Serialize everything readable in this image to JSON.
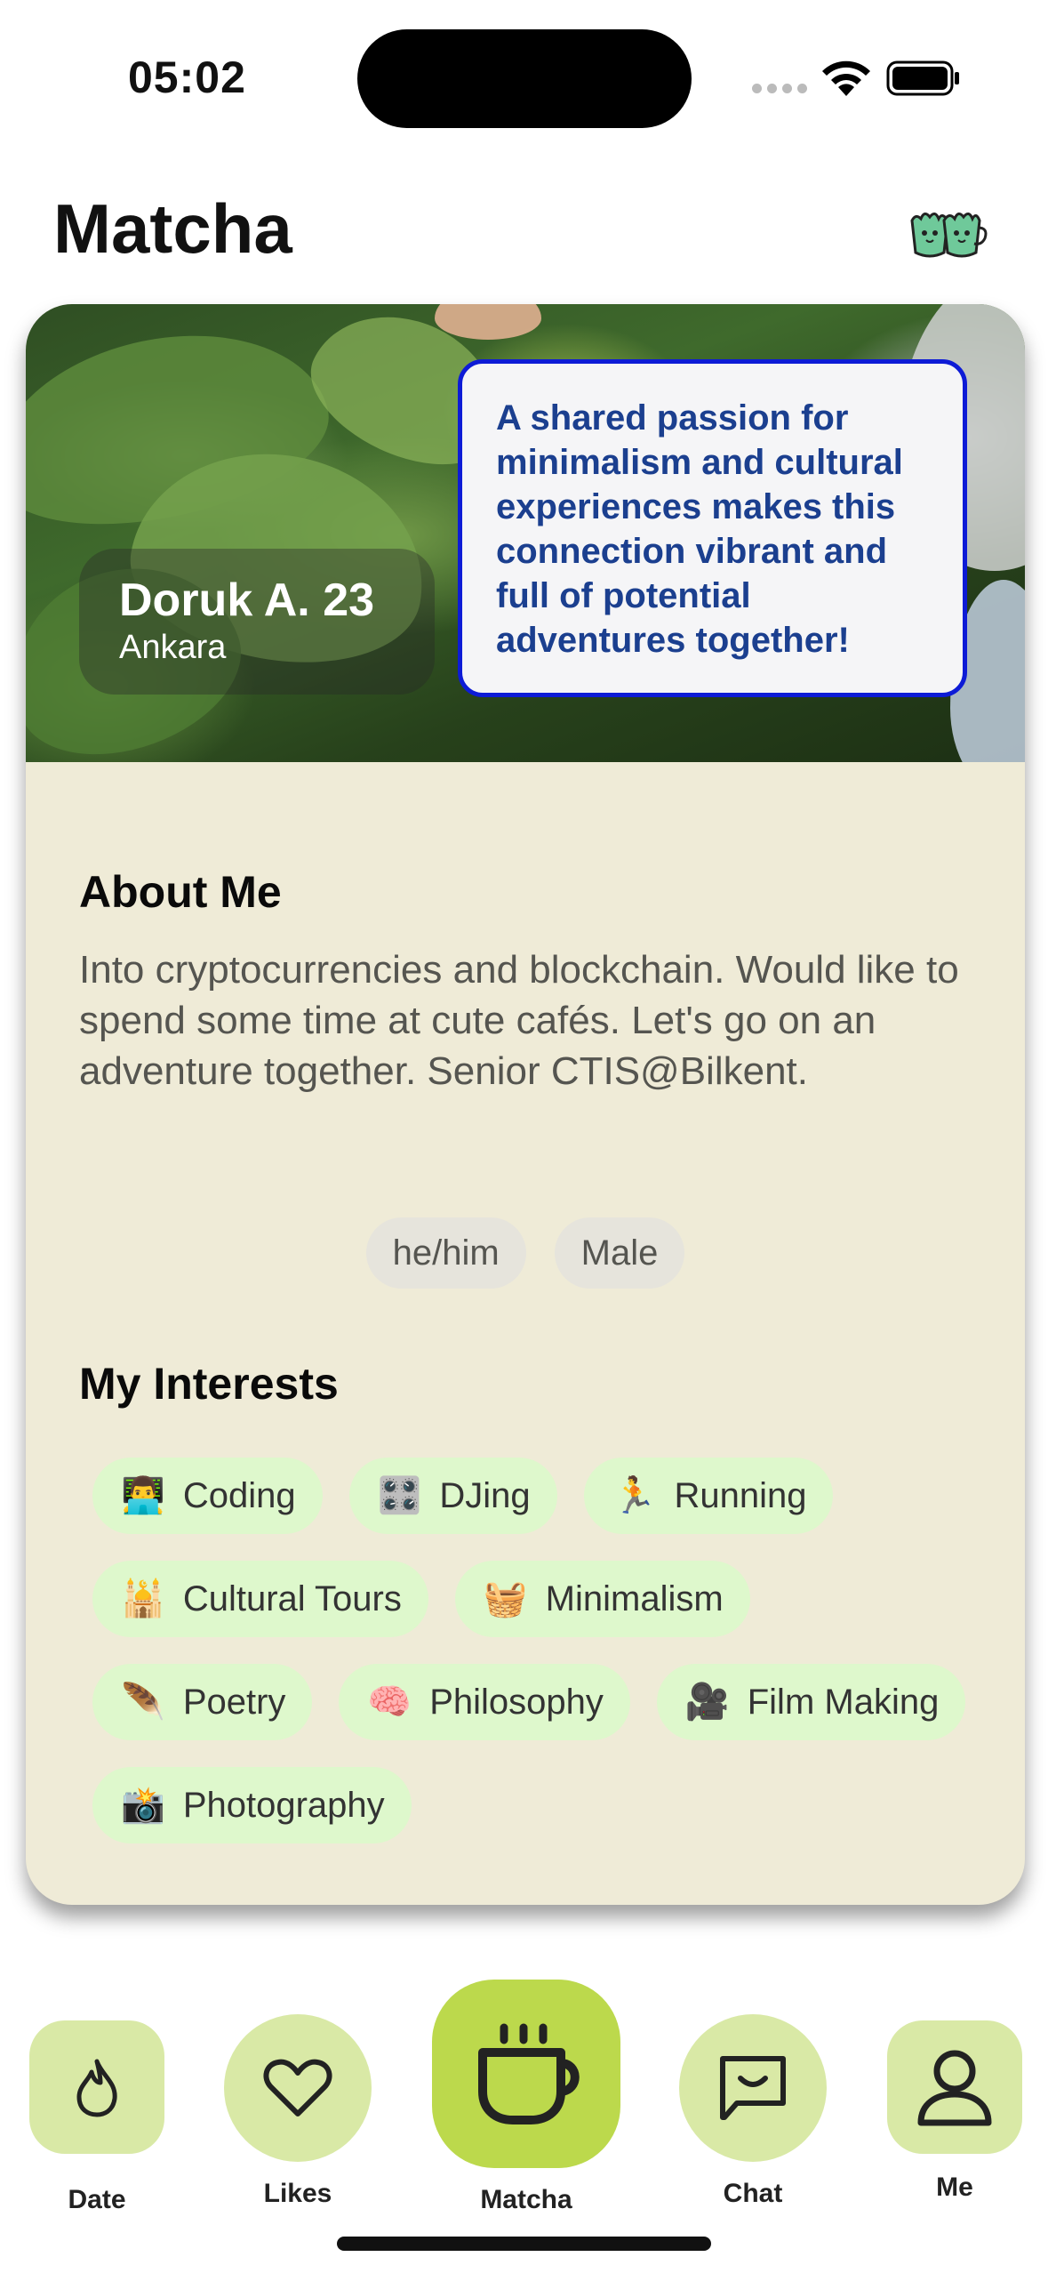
{
  "status_bar": {
    "time": "05:02"
  },
  "header": {
    "title": "Matcha",
    "logo_icon": "matcha-cups-logo"
  },
  "profile": {
    "name_age": "Doruk A. 23",
    "city": "Ankara",
    "match_note": "A shared passion for minimalism and cultural experiences makes this connection vibrant and full of potential adventures together!",
    "about_title": "About Me",
    "about_text": "Into cryptocurrencies and blockchain. Would like to spend some time at cute cafés. Let's go on an adventure together. Senior CTIS@Bilkent.",
    "pronouns": "he/him",
    "gender": "Male",
    "interests_title": "My Interests",
    "interests": [
      {
        "emoji": "👨‍💻",
        "label": "Coding"
      },
      {
        "emoji": "🎛️",
        "label": "DJing"
      },
      {
        "emoji": "🏃",
        "label": "Running"
      },
      {
        "emoji": "🕌",
        "label": "Cultural Tours"
      },
      {
        "emoji": "🧺",
        "label": "Minimalism"
      },
      {
        "emoji": "🪶",
        "label": "Poetry"
      },
      {
        "emoji": "🧠",
        "label": "Philosophy"
      },
      {
        "emoji": "🎥",
        "label": "Film Making"
      },
      {
        "emoji": "📸",
        "label": "Photography"
      }
    ]
  },
  "tab_bar": {
    "items": [
      {
        "label": "Date",
        "icon": "flame-icon"
      },
      {
        "label": "Likes",
        "icon": "heart-icon"
      },
      {
        "label": "Matcha",
        "icon": "cup-icon"
      },
      {
        "label": "Chat",
        "icon": "chat-icon"
      },
      {
        "label": "Me",
        "icon": "person-icon"
      }
    ],
    "selected": "Matcha"
  },
  "colors": {
    "card_bg": "#efebd7",
    "chip_bg": "#def8cc",
    "tab_bg": "#d9e9a6",
    "tab_active_bg": "#bcd94c",
    "bubble_border": "#0d1bd6",
    "bubble_text": "#1b3f8f"
  }
}
